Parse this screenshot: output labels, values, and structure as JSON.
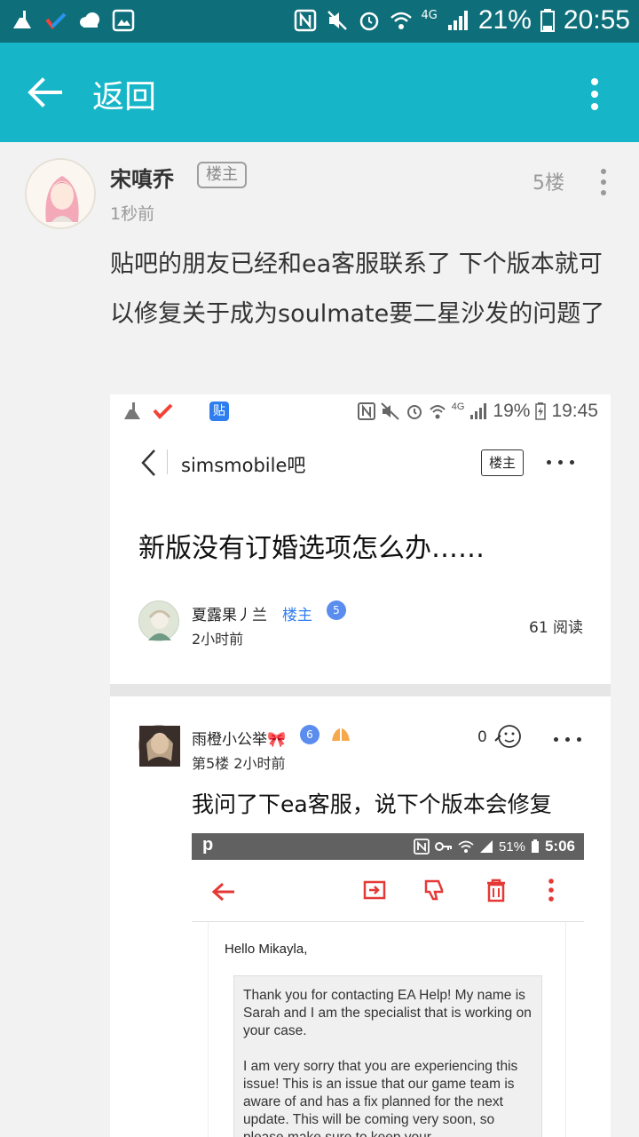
{
  "status_bar": {
    "battery_percent": "21%",
    "time": "20:55",
    "network": "4G"
  },
  "app_bar": {
    "title": "返回"
  },
  "post": {
    "username": "宋嗔乔",
    "owner_badge": "楼主",
    "time": "1秒前",
    "floor": "5楼",
    "text": "贴吧的朋友已经和ea客服联系了 下个版本就可以修复关于成为soulmate要二星沙发的问题了"
  },
  "embedded": {
    "status": {
      "battery_percent": "19%",
      "time": "19:45",
      "tieba_badge": "贴",
      "network": "4G"
    },
    "nav": {
      "forum": "simsmobile吧",
      "owner_badge": "楼主"
    },
    "thread_title": "新版没有订婚选项怎么办……",
    "op": {
      "name": "夏露果丿兰",
      "tag": "楼主",
      "level": "5",
      "time": "2小时前",
      "reads": "61 阅读"
    },
    "reply": {
      "name": "雨橙小公举🎀",
      "level": "6",
      "floor_time": "第5楼   2小时前",
      "like_count": "0",
      "text": "我问了下ea客服，说下个版本会修复"
    },
    "mail": {
      "status": {
        "carrier": "p",
        "battery_percent": "51%",
        "time": "5:06"
      },
      "greeting": "Hello Mikayla,",
      "paragraph1": "Thank you for contacting EA Help! My name is Sarah and I am the specialist that is working on your case.",
      "paragraph2": "I am very sorry that you are experiencing this issue! This is an issue that our game team is aware of and has a fix planned for the next update. This will be coming very soon, so please make sure to keep your"
    }
  },
  "colors": {
    "status_bar_bg": "#0e6f7a",
    "app_bar_bg": "#16b6c8",
    "page_bg": "#f2f2f2",
    "mail_accent": "#e53935",
    "link_blue": "#2f7ef0"
  }
}
